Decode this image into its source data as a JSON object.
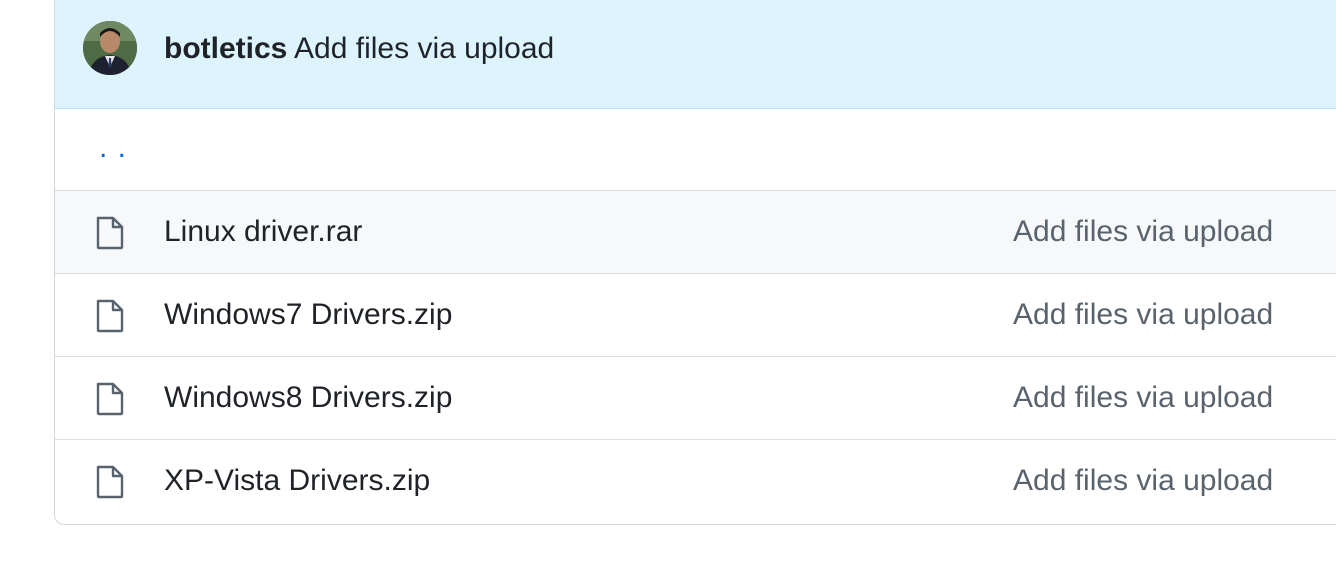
{
  "latest_commit": {
    "author": "botletics",
    "message": "Add files via upload"
  },
  "parent_directory": {
    "label": ". ."
  },
  "files": [
    {
      "name": "Linux driver.rar",
      "commit_message": "Add files via upload",
      "icon": "file-icon"
    },
    {
      "name": "Windows7 Drivers.zip",
      "commit_message": "Add files via upload",
      "icon": "file-icon"
    },
    {
      "name": "Windows8 Drivers.zip",
      "commit_message": "Add files via upload",
      "icon": "file-icon"
    },
    {
      "name": "XP-Vista Drivers.zip",
      "commit_message": "Add files via upload",
      "icon": "file-icon"
    }
  ],
  "colors": {
    "header_background": "#ddf4ff",
    "link": "#0969da",
    "text": "#1f2328",
    "muted_text": "#59636e",
    "row_hover": "#f6f8fa",
    "border": "#d0d7de"
  }
}
